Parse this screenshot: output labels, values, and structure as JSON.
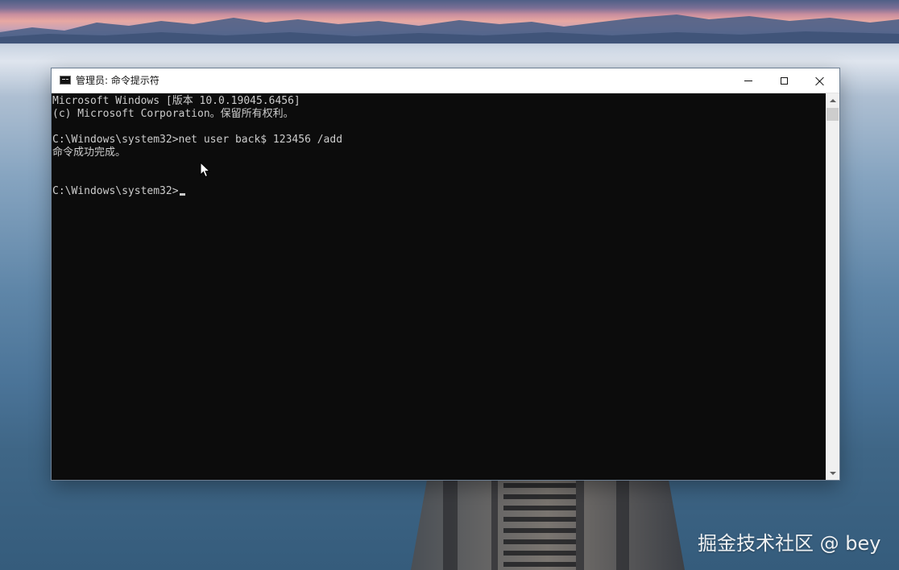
{
  "window": {
    "title": "管理员: 命令提示符",
    "icon": "cmd-icon",
    "controls": {
      "minimize_icon": "minimize-icon",
      "maximize_icon": "maximize-icon",
      "close_icon": "close-icon"
    }
  },
  "console": {
    "lines": [
      "Microsoft Windows [版本 10.0.19045.6456]",
      "(c) Microsoft Corporation。保留所有权利。",
      "",
      "C:\\Windows\\system32>net user back$ 123456 /add",
      "命令成功完成。",
      "",
      "",
      "C:\\Windows\\system32>"
    ],
    "text_color": "#cccccc",
    "background_color": "#0c0c0c"
  },
  "watermark": "掘金技术社区 @ bey"
}
